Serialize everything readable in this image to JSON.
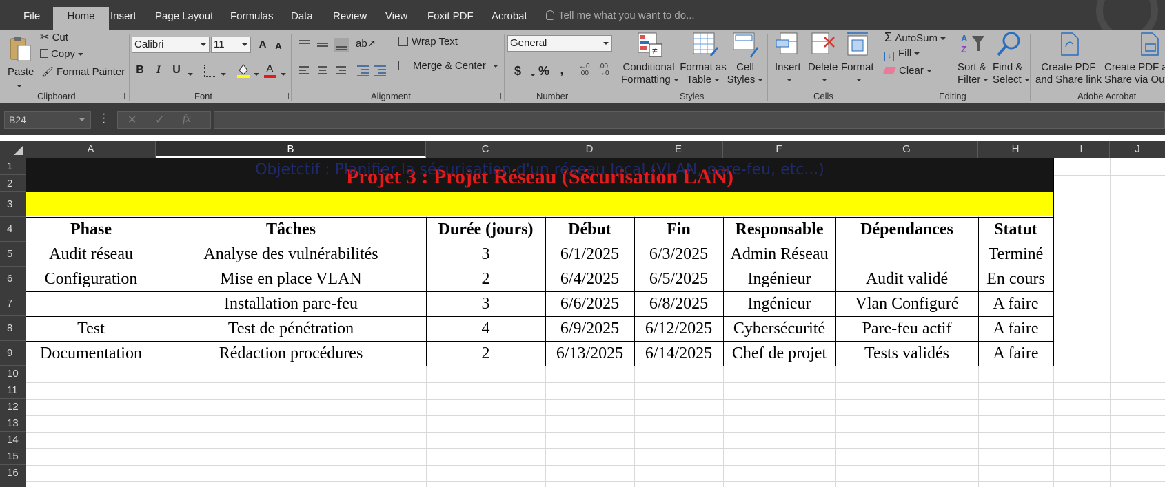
{
  "menu": {
    "tabs": [
      "File",
      "Home",
      "Insert",
      "Page Layout",
      "Formulas",
      "Data",
      "Review",
      "View",
      "Foxit PDF",
      "Acrobat"
    ],
    "active_tab": "Home",
    "tell_me": "Tell me what you want to do..."
  },
  "ribbon": {
    "clipboard": {
      "paste": "Paste",
      "cut": "Cut",
      "copy": "Copy",
      "format_painter": "Format Painter",
      "label": "Clipboard"
    },
    "font": {
      "name": "Calibri",
      "size": "11",
      "bold": "B",
      "italic": "I",
      "underline": "U",
      "grow": "A",
      "shrink": "A",
      "label": "Font"
    },
    "alignment": {
      "wrap_text": "Wrap Text",
      "merge_center": "Merge & Center",
      "label": "Alignment"
    },
    "number": {
      "format": "General",
      "currency": "$",
      "percent": "%",
      "comma": ",",
      "label": "Number"
    },
    "styles": {
      "conditional_formatting_1": "Conditional",
      "conditional_formatting_2": "Formatting",
      "format_as_table_1": "Format as",
      "format_as_table_2": "Table",
      "cell_styles_1": "Cell",
      "cell_styles_2": "Styles",
      "label": "Styles"
    },
    "cells": {
      "insert": "Insert",
      "delete": "Delete",
      "format": "Format",
      "label": "Cells"
    },
    "editing": {
      "autosum": "AutoSum",
      "fill": "Fill",
      "clear": "Clear",
      "sort_filter_1": "Sort &",
      "sort_filter_2": "Filter",
      "find_select_1": "Find &",
      "find_select_2": "Select",
      "label": "Editing"
    },
    "acrobat": {
      "create_pdf_share_1": "Create PDF",
      "create_pdf_share_2": "and Share link",
      "create_pdf_out_1": "Create PDF a",
      "create_pdf_out_2": "Share via Out",
      "label": "Adobe Acrobat"
    }
  },
  "formula_bar": {
    "name_box": "B24",
    "fx": "fx",
    "value": ""
  },
  "columns": [
    "A",
    "B",
    "C",
    "D",
    "E",
    "F",
    "G",
    "H",
    "I",
    "J"
  ],
  "selected_column": "B",
  "rows": [
    "1",
    "2",
    "3",
    "4",
    "5",
    "6",
    "7",
    "8",
    "9",
    "10",
    "11",
    "12",
    "13",
    "14",
    "15",
    "16"
  ],
  "sheet": {
    "title": "Projet 3 : Projet Réseau (Sécurisation LAN)",
    "objective": "Objetctif : Planifier la sécurisation d'un réseau local (VLAN, pare-feu, etc...)",
    "headers": [
      "Phase",
      "Tâches",
      "Durée (jours)",
      "Début",
      "Fin",
      "Responsable",
      "Dépendances",
      "Statut"
    ],
    "table": [
      [
        "Audit réseau",
        "Analyse des vulnérabilités",
        "3",
        "6/1/2025",
        "6/3/2025",
        "Admin Réseau",
        "",
        "Terminé"
      ],
      [
        "Configuration",
        "Mise en place VLAN",
        "2",
        "6/4/2025",
        "6/5/2025",
        "Ingénieur",
        "Audit validé",
        "En cours"
      ],
      [
        "",
        "Installation pare-feu",
        "3",
        "6/6/2025",
        "6/8/2025",
        "Ingénieur",
        "Vlan Configuré",
        "A faire"
      ],
      [
        "Test",
        "Test de pénétration",
        "4",
        "6/9/2025",
        "6/12/2025",
        "Cybersécurité",
        "Pare-feu actif",
        "A faire"
      ],
      [
        "Documentation",
        "Rédaction procédures",
        "2",
        "6/13/2025",
        "6/14/2025",
        "Chef de projet",
        "Tests validés",
        "A faire"
      ]
    ]
  },
  "colors": {
    "title_red": "#e8191b",
    "title_band": "#161616",
    "objective_band": "#ffff00",
    "objective_text": "#1e2a6b"
  }
}
